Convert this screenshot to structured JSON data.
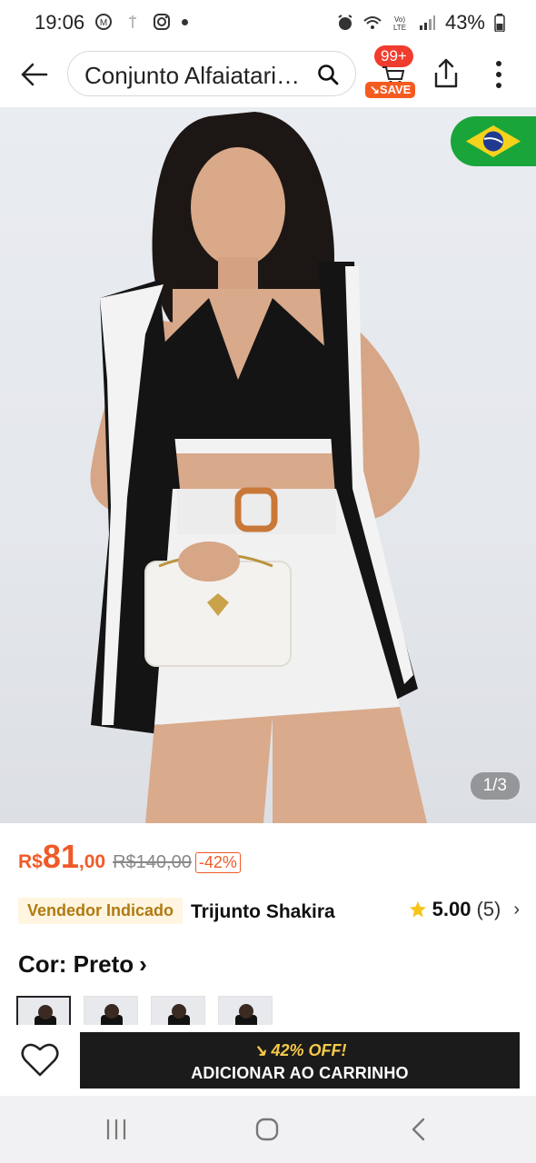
{
  "status_bar": {
    "time": "19:06",
    "battery": "43%",
    "icons": [
      "signal-icon",
      "instagram-icon",
      "alarm-icon",
      "wifi-icon",
      "volte-icon",
      "cell-signal-icon",
      "battery-icon"
    ]
  },
  "header": {
    "search_text": "Conjunto Alfaiataria...",
    "cart_badge": "99+",
    "save_label": "SAVE"
  },
  "gallery": {
    "counter": "1/3",
    "flag": "brazil-flag"
  },
  "price": {
    "currency": "R$",
    "integer": "81",
    "decimal": ",00",
    "old_price": "R$140,00",
    "discount": "-42%"
  },
  "seller": {
    "tag": "Vendedor Indicado",
    "name": "Trijunto Shakira",
    "rating": "5.00",
    "rating_count": "(5)"
  },
  "color": {
    "label": "Cor: Preto",
    "thumbnails": 4,
    "selected_index": 0
  },
  "action_bar": {
    "promo": "42% OFF!",
    "add_to_cart": "ADICIONAR AO CARRINHO"
  },
  "colors": {
    "accent": "#f05a28",
    "button_bg": "#1b1b1b",
    "promo_text": "#f7c948",
    "seller_tag_bg": "#fff5e0"
  }
}
